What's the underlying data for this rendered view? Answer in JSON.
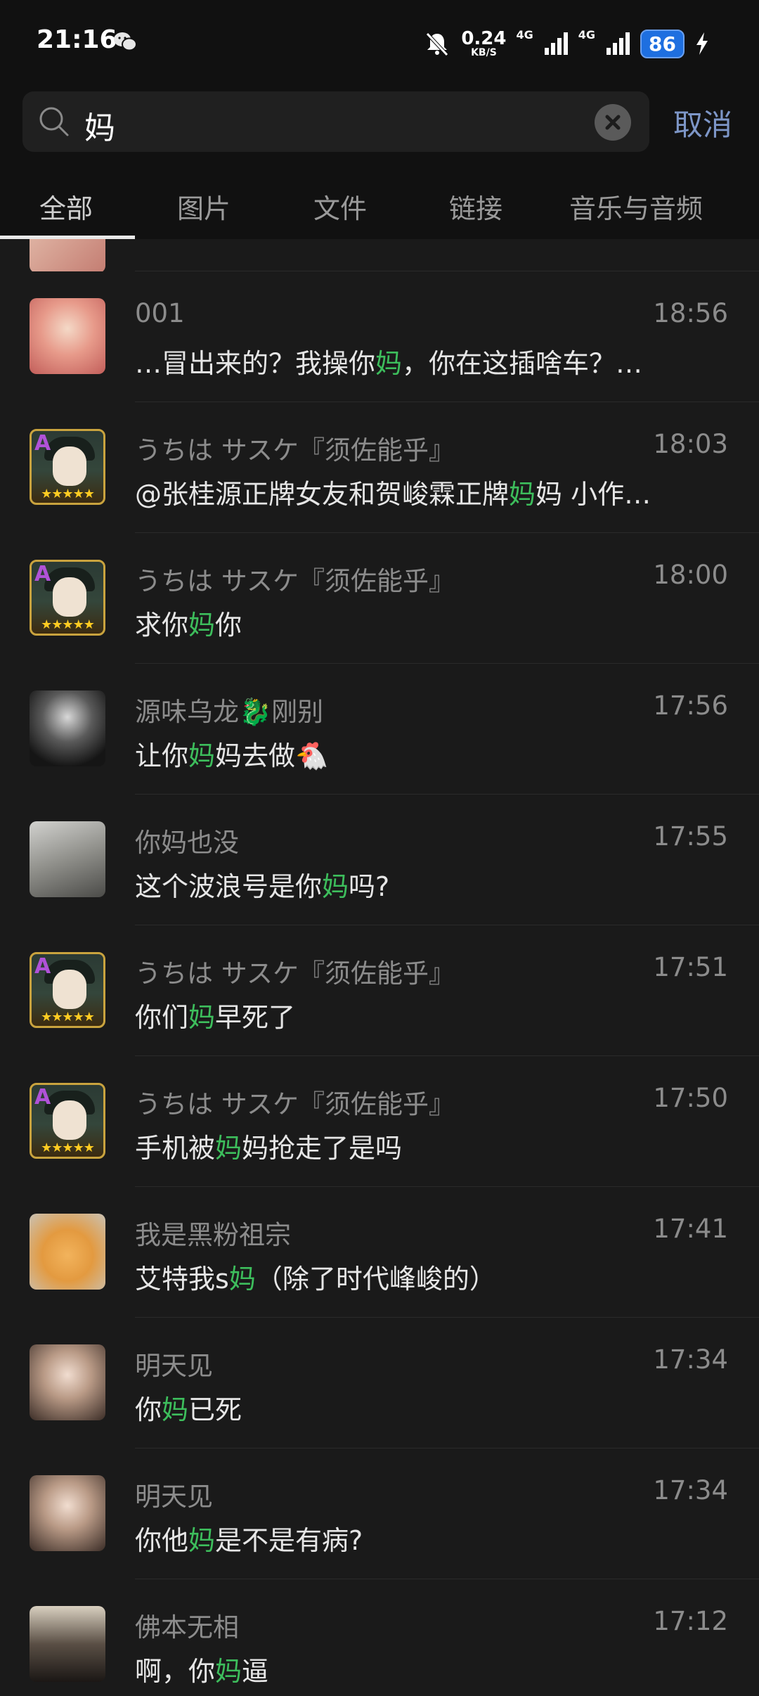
{
  "status_bar": {
    "time": "21:16",
    "speed_value": "0.24",
    "speed_unit": "KB/S",
    "network_1": "4G",
    "network_2": "4G",
    "battery": "86"
  },
  "search": {
    "query": "妈",
    "cancel_label": "取消"
  },
  "tabs": [
    {
      "label": "全部",
      "active": true
    },
    {
      "label": "图片",
      "active": false
    },
    {
      "label": "文件",
      "active": false
    },
    {
      "label": "链接",
      "active": false
    },
    {
      "label": "音乐与音频",
      "active": false
    }
  ],
  "colors": {
    "background": "#1a1a1a",
    "highlight": "#3dbe5c",
    "cancel": "#7d96c7",
    "battery": "#1e6fe0"
  },
  "results": [
    {
      "avatar": "anime-pink",
      "name": "001",
      "time": "18:56",
      "pre": "…冒出来的？我操你",
      "hl": "妈",
      "post": "，你在这插啥车？…"
    },
    {
      "avatar": "sasuke",
      "name": "うちは サスケ『须佐能乎』",
      "time": "18:03",
      "pre": "@张桂源正牌女友和贺峻霖正牌",
      "hl": "妈",
      "post": "妈 小作…"
    },
    {
      "avatar": "sasuke",
      "name": "うちは サスケ『须佐能乎』",
      "time": "18:00",
      "pre": "求你",
      "hl": "妈",
      "post": "你"
    },
    {
      "avatar": "dark",
      "name": "源味乌龙🐉刚别",
      "time": "17:56",
      "pre": "让你",
      "hl": "妈",
      "post": "妈去做🐔"
    },
    {
      "avatar": "bed",
      "name": "你妈也没",
      "time": "17:55",
      "pre": "这个波浪号是你",
      "hl": "妈",
      "post": "吗?"
    },
    {
      "avatar": "sasuke",
      "name": "うちは サスケ『须佐能乎』",
      "time": "17:51",
      "pre": "你们",
      "hl": "妈",
      "post": "早死了"
    },
    {
      "avatar": "sasuke",
      "name": "うちは サスケ『须佐能乎』",
      "time": "17:50",
      "pre": "手机被",
      "hl": "妈",
      "post": "妈抢走了是吗"
    },
    {
      "avatar": "cat",
      "name": "我是黑粉祖宗",
      "time": "17:41",
      "pre": "艾特我s",
      "hl": "妈",
      "post": "（除了时代峰峻的）"
    },
    {
      "avatar": "girl",
      "name": "明天见",
      "time": "17:34",
      "pre": "你",
      "hl": "妈",
      "post": "已死"
    },
    {
      "avatar": "girl",
      "name": "明天见",
      "time": "17:34",
      "pre": "你他",
      "hl": "妈",
      "post": "是不是有病?"
    },
    {
      "avatar": "man",
      "name": "佛本无相",
      "time": "17:12",
      "pre": "啊，你",
      "hl": "妈",
      "post": "逼"
    }
  ]
}
